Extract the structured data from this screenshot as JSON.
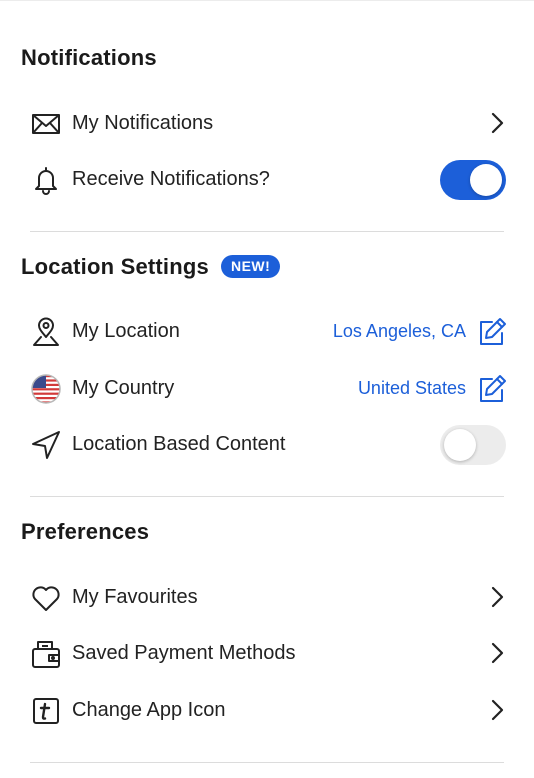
{
  "sections": {
    "notifications": {
      "title": "Notifications",
      "my_notifications_label": "My Notifications",
      "receive_label": "Receive Notifications?",
      "receive_enabled": true
    },
    "location": {
      "title": "Location Settings",
      "badge": "NEW!",
      "my_location_label": "My Location",
      "my_location_value": "Los Angeles, CA",
      "my_country_label": "My Country",
      "my_country_value": "United States",
      "location_content_label": "Location Based Content",
      "location_content_enabled": false
    },
    "preferences": {
      "title": "Preferences",
      "favourites_label": "My Favourites",
      "payment_label": "Saved Payment Methods",
      "app_icon_label": "Change App Icon"
    }
  },
  "colors": {
    "accent": "#1c5fd9",
    "toggle_off": "#ececec",
    "divider": "#dcdcdc"
  }
}
